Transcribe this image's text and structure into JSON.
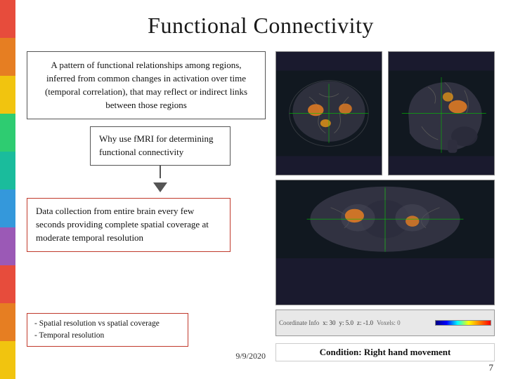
{
  "slide": {
    "title": "Functional Connectivity",
    "definition": {
      "text": "A pattern of functional relationships among regions, inferred from common changes in activation over time (temporal correlation), that may reflect or indirect links between those regions"
    },
    "why_fmri": {
      "label": "Why use fMRI for determining functional connectivity"
    },
    "data_collection": {
      "text": "Data collection from entire brain every few seconds providing complete spatial coverage at moderate temporal resolution"
    },
    "spatial": {
      "line1": "- Spatial resolution vs spatial coverage",
      "line2": "- Temporal resolution"
    },
    "date": "9/9/2020",
    "condition": "Condition: Right hand movement",
    "page_number": "7"
  },
  "colors": {
    "left_bar": [
      "#e74c3c",
      "#e67e22",
      "#f1c40f",
      "#2ecc71",
      "#1abc9c",
      "#3498db",
      "#9b59b6",
      "#e74c3c",
      "#e67e22",
      "#f1c40f"
    ],
    "accent_red": "#c0392b"
  }
}
